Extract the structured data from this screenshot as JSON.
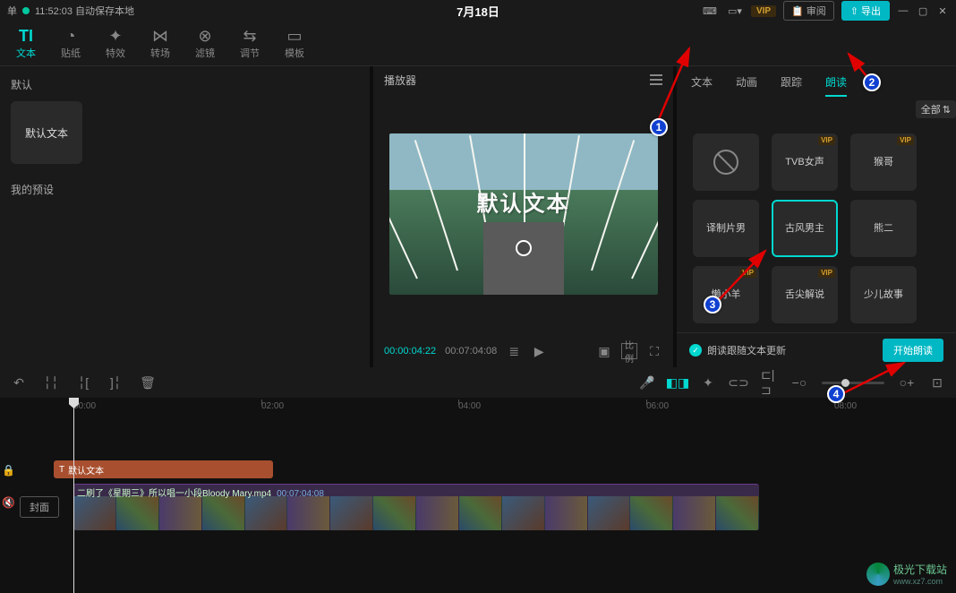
{
  "titlebar": {
    "menu_label": "单",
    "autosave": "11:52:03 自动保存本地",
    "title": "7月18日",
    "vip": "VIP",
    "review": "审阅",
    "export": "导出"
  },
  "toolbar": {
    "tabs": [
      {
        "label": "文本",
        "icon": "TI"
      },
      {
        "label": "贴纸",
        "icon": "◔"
      },
      {
        "label": "特效",
        "icon": "✦"
      },
      {
        "label": "转场",
        "icon": "⋈"
      },
      {
        "label": "滤镜",
        "icon": "⊗"
      },
      {
        "label": "调节",
        "icon": "⇆"
      },
      {
        "label": "模板",
        "icon": "▭"
      }
    ]
  },
  "left": {
    "default_label": "默认",
    "preset_text": "默认文本",
    "my_presets": "我的预设"
  },
  "player": {
    "title": "播放器",
    "overlay": "默认文本",
    "current_time": "00:00:04:22",
    "duration": "00:07:04:08",
    "ratio_label": "比例"
  },
  "right": {
    "tabs": [
      "文本",
      "动画",
      "跟踪",
      "朗读"
    ],
    "active_tab": 3,
    "filter_all": "全部",
    "voices": [
      {
        "label": "",
        "ban": true
      },
      {
        "label": "TVB女声",
        "vip": true
      },
      {
        "label": "猴哥",
        "vip": true
      },
      {
        "label": "译制片男"
      },
      {
        "label": "古风男主",
        "selected": true
      },
      {
        "label": "熊二"
      },
      {
        "label": "懒小羊",
        "vip": true
      },
      {
        "label": "舌尖解说",
        "vip": true
      },
      {
        "label": "少儿故事"
      }
    ],
    "follow_text": "朗读跟随文本更新",
    "start_label": "开始朗读"
  },
  "timeline": {
    "ticks": [
      "00:00",
      "02:00",
      "04:00",
      "06:00",
      "08:00"
    ],
    "cover_label": "封面",
    "text_clip": "默认文本",
    "video_clip_name": "二刷了《星期三》所以唱一小段Bloody Mary.mp4",
    "video_clip_dur": "00:07:04:08"
  },
  "watermark": {
    "name": "极光下载站",
    "url": "www.xz7.com"
  },
  "annotations": [
    "1",
    "2",
    "3",
    "4"
  ]
}
